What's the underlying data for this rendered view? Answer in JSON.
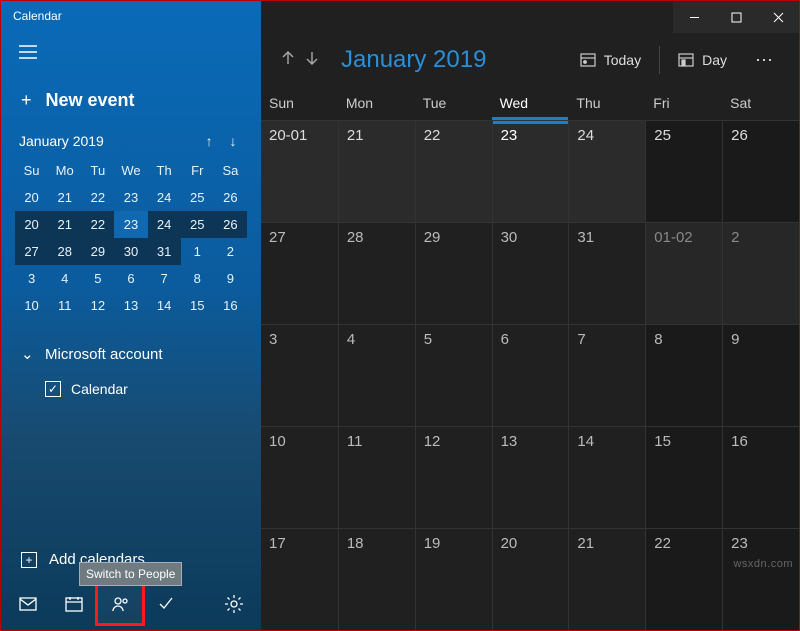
{
  "window": {
    "title": "Calendar"
  },
  "sidebar": {
    "new_event": "New event",
    "mini": {
      "title": "January 2019",
      "dow": [
        "Su",
        "Mo",
        "Tu",
        "We",
        "Th",
        "Fr",
        "Sa"
      ],
      "weeks": [
        [
          {
            "n": "20",
            "cur": false
          },
          {
            "n": "21",
            "cur": false
          },
          {
            "n": "22",
            "cur": false
          },
          {
            "n": "23",
            "cur": false
          },
          {
            "n": "24",
            "cur": false
          },
          {
            "n": "25",
            "cur": false
          },
          {
            "n": "26",
            "cur": false
          }
        ],
        [
          {
            "n": "20",
            "cur": true
          },
          {
            "n": "21",
            "cur": true
          },
          {
            "n": "22",
            "cur": true
          },
          {
            "n": "23",
            "cur": true,
            "today": true
          },
          {
            "n": "24",
            "cur": true
          },
          {
            "n": "25",
            "cur": true
          },
          {
            "n": "26",
            "cur": true
          }
        ],
        [
          {
            "n": "27",
            "cur": true
          },
          {
            "n": "28",
            "cur": true
          },
          {
            "n": "29",
            "cur": true
          },
          {
            "n": "30",
            "cur": true
          },
          {
            "n": "31",
            "cur": true
          },
          {
            "n": "1",
            "cur": false
          },
          {
            "n": "2",
            "cur": false
          }
        ],
        [
          {
            "n": "3",
            "cur": false
          },
          {
            "n": "4",
            "cur": false
          },
          {
            "n": "5",
            "cur": false
          },
          {
            "n": "6",
            "cur": false
          },
          {
            "n": "7",
            "cur": false
          },
          {
            "n": "8",
            "cur": false
          },
          {
            "n": "9",
            "cur": false
          }
        ],
        [
          {
            "n": "10",
            "cur": false
          },
          {
            "n": "11",
            "cur": false
          },
          {
            "n": "12",
            "cur": false
          },
          {
            "n": "13",
            "cur": false
          },
          {
            "n": "14",
            "cur": false
          },
          {
            "n": "15",
            "cur": false
          },
          {
            "n": "16",
            "cur": false
          }
        ]
      ]
    },
    "account": "Microsoft account",
    "calendar_item": "Calendar",
    "add_calendars": "Add calendars",
    "tooltip": "Switch to People"
  },
  "main": {
    "month": "January 2019",
    "today": "Today",
    "day": "Day",
    "dow": [
      "Sun",
      "Mon",
      "Tue",
      "Wed",
      "Thu",
      "Fri",
      "Sat"
    ],
    "today_index": 3,
    "rows": [
      [
        {
          "n": "20-01"
        },
        {
          "n": "21"
        },
        {
          "n": "22"
        },
        {
          "n": "23",
          "today": true
        },
        {
          "n": "24"
        },
        {
          "n": "25"
        },
        {
          "n": "26"
        }
      ],
      [
        {
          "n": "27"
        },
        {
          "n": "28"
        },
        {
          "n": "29"
        },
        {
          "n": "30"
        },
        {
          "n": "31"
        },
        {
          "n": "01-02",
          "out": true
        },
        {
          "n": "2",
          "out": true
        }
      ],
      [
        {
          "n": "3"
        },
        {
          "n": "4"
        },
        {
          "n": "5"
        },
        {
          "n": "6"
        },
        {
          "n": "7"
        },
        {
          "n": "8"
        },
        {
          "n": "9"
        }
      ],
      [
        {
          "n": "10"
        },
        {
          "n": "11"
        },
        {
          "n": "12"
        },
        {
          "n": "13"
        },
        {
          "n": "14"
        },
        {
          "n": "15"
        },
        {
          "n": "16"
        }
      ],
      [
        {
          "n": "17"
        },
        {
          "n": "18"
        },
        {
          "n": "19"
        },
        {
          "n": "20"
        },
        {
          "n": "21"
        },
        {
          "n": "22"
        },
        {
          "n": "23"
        }
      ]
    ]
  },
  "watermark": "wsxdn.com"
}
